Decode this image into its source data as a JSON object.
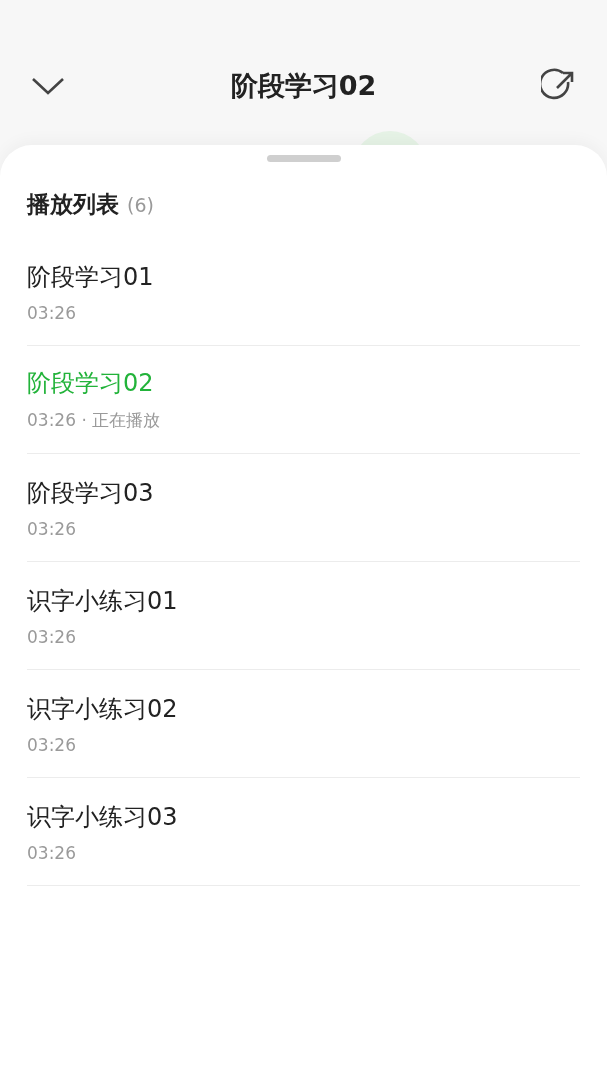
{
  "header": {
    "title": "阶段学习02"
  },
  "playlist": {
    "title": "播放列表",
    "count": "(6)",
    "items": [
      {
        "title": "阶段学习01",
        "duration": "03:26",
        "selected": false
      },
      {
        "title": "阶段学习02",
        "duration": "03:26",
        "separator": "·",
        "status": "正在播放",
        "selected": true
      },
      {
        "title": "阶段学习03",
        "duration": "03:26",
        "selected": false
      },
      {
        "title": "识字小练习01",
        "duration": "03:26",
        "selected": false
      },
      {
        "title": "识字小练习02",
        "duration": "03:26",
        "selected": false
      },
      {
        "title": "识字小练习03",
        "duration": "03:26",
        "selected": false
      }
    ]
  }
}
